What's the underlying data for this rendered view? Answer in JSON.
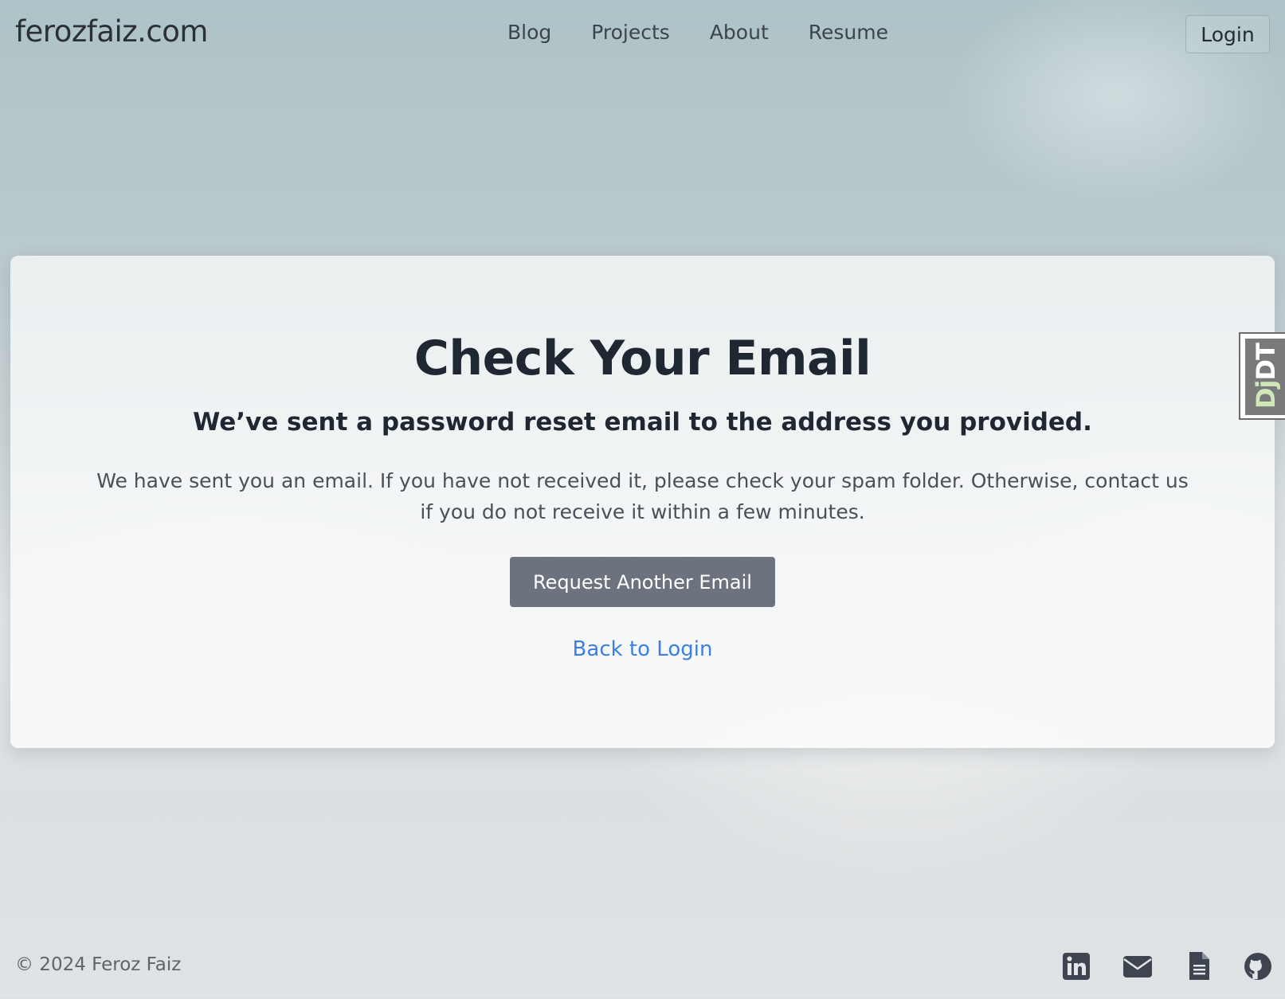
{
  "header": {
    "brand": "ferozfaiz.com",
    "nav": [
      "Blog",
      "Projects",
      "About",
      "Resume"
    ],
    "login_label": "Login"
  },
  "card": {
    "title": "Check Your Email",
    "subtitle": "We’ve sent a password reset email to the address you provided.",
    "body": "We have sent you an email. If you have not received it, please check your spam folder. Otherwise, contact us if you do not receive it within a few minutes.",
    "request_button": "Request Another Email",
    "back_link": "Back to Login"
  },
  "debug_toolbar": {
    "label_dj": "Dj",
    "label_dt": "DT"
  },
  "footer": {
    "copyright": "© 2024 Feroz Faiz",
    "icons": [
      "linkedin-icon",
      "email-icon",
      "document-icon",
      "github-icon"
    ]
  },
  "colors": {
    "accent_link": "#3b7fe0",
    "button_bg": "#6c737f",
    "heading": "#1f2733"
  }
}
